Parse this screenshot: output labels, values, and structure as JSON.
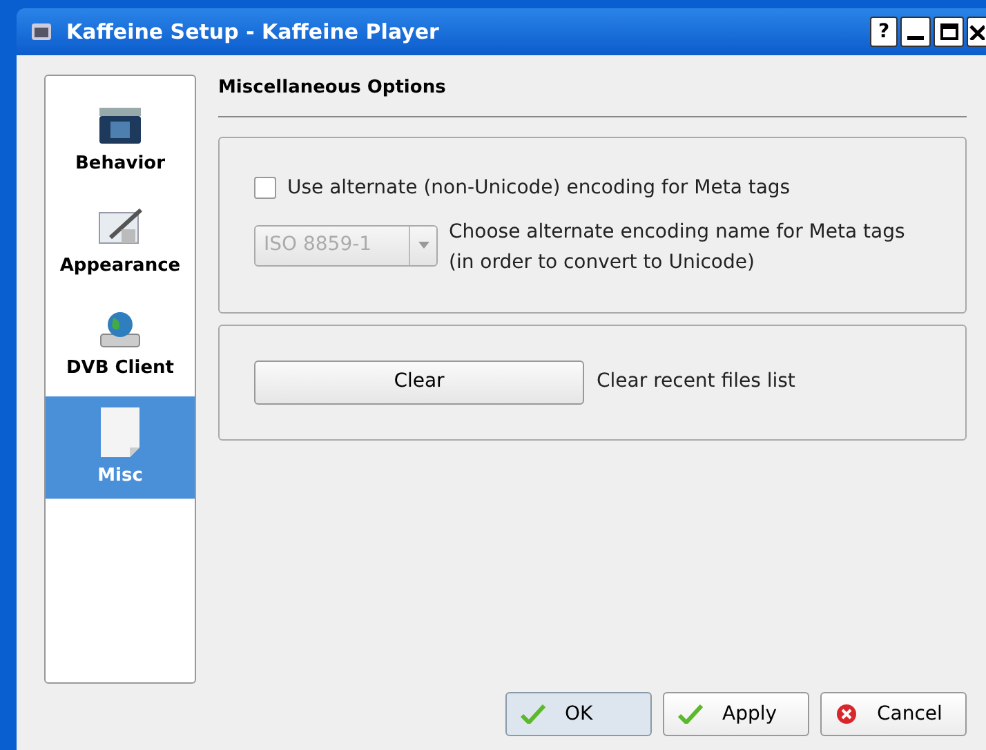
{
  "window": {
    "title": "Kaffeine Setup - Kaffeine Player",
    "controls": [
      "?"
    ]
  },
  "sidebar": {
    "items": [
      {
        "label": "Behavior",
        "kind": "kde",
        "selected": false
      },
      {
        "label": "Appearance",
        "kind": "paint",
        "selected": false
      },
      {
        "label": "DVB Client",
        "kind": "globe",
        "selected": false
      },
      {
        "label": "Misc",
        "kind": "page",
        "selected": true
      }
    ]
  },
  "page": {
    "title": "Miscellaneous Options",
    "encoding": {
      "checkbox": {
        "label": "Use alternate (non-Unicode) encoding for Meta tags",
        "checked": false
      },
      "select": {
        "value": "ISO 8859-1",
        "disabled": true
      },
      "description": "Choose alternate encoding name for Meta tags (in order to convert to Unicode)"
    },
    "recent": {
      "button": "Clear",
      "description": "Clear recent files list"
    }
  },
  "buttons": [
    {
      "label": "OK",
      "kind": "check",
      "selected": true
    },
    {
      "label": "Apply",
      "kind": "check",
      "selected": false
    },
    {
      "label": "Cancel",
      "kind": "cancel",
      "selected": false
    }
  ]
}
